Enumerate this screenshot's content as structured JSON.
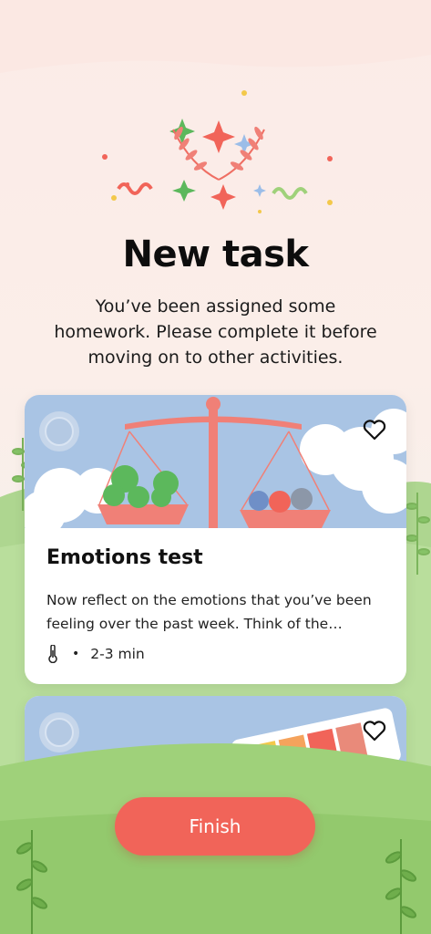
{
  "header": {
    "title": "New task",
    "subtitle": "You’ve been assigned some homework. Please complete it before moving on to other activities."
  },
  "tasks": [
    {
      "title": "Emotions test",
      "description": "Now reflect on the emotions that you’ve been feeling over the past week. Think of the emotions you felt most often and how strongly.",
      "separator": "•",
      "duration": "2-3 min",
      "icons": [
        "thermometer-icon",
        "heart-icon"
      ],
      "illustration": "balance-scale"
    },
    {
      "icons": [
        "heart-icon"
      ],
      "illustration": "color-swatches"
    }
  ],
  "actions": {
    "finish_label": "Finish"
  },
  "colors": {
    "accent": "#f16459",
    "background": "#fbebe7",
    "card_sky": "#a9c4e4",
    "grass": "#9fd17a"
  }
}
